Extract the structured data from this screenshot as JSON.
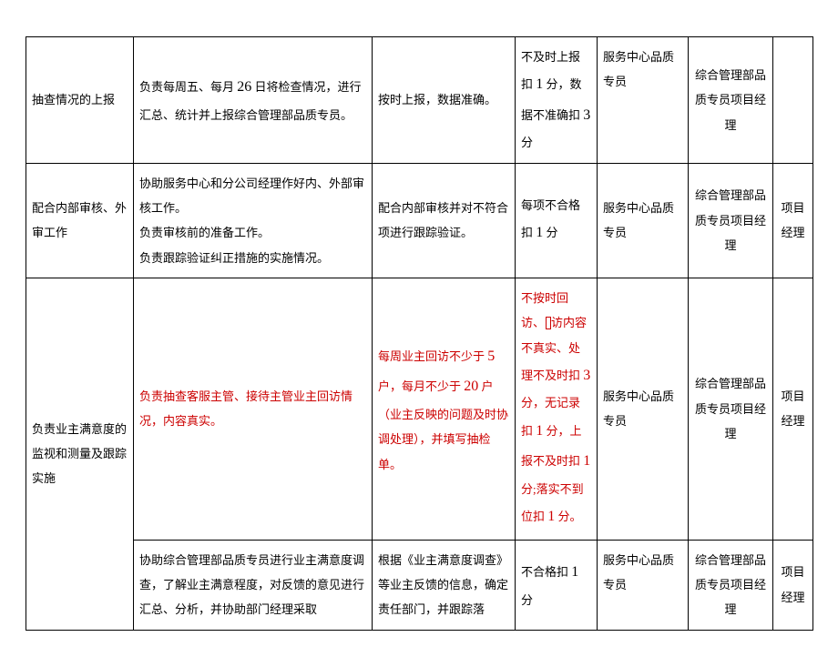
{
  "rows": {
    "r1": {
      "c1": "抽查情况的上报",
      "c2_a": "负责每周五、每月 ",
      "c2_num": "26",
      "c2_b": " 日将检查情况，进行汇总、统计并上报综合管理部品质专员。",
      "c3": "按时上报，数据准确。",
      "c4_a": "不及时上报扣 ",
      "c4_n1": "1",
      "c4_b": " 分，数据不准确扣 ",
      "c4_n2": "3",
      "c4_c": " 分",
      "c5": "服务中心品质专员",
      "c6": "综合管理部品质专员项目经理",
      "c7": ""
    },
    "r2": {
      "c1": "配合内部审核、外审工作",
      "c2_l1": "协助服务中心和分公司经理作好内、外部审核工作。",
      "c2_l2": "负责审核前的准备工作。",
      "c2_l3": "负责跟踪验证纠正措施的实施情况。",
      "c3": "配合内部审核并对不符合项进行跟踪验证。",
      "c4_a": "每项不合格扣 ",
      "c4_n1": "1",
      "c4_b": " 分",
      "c5": "服务中心品质专员",
      "c6": "综合管理部品质专员项目经理",
      "c7": "项目经理"
    },
    "r3": {
      "c1": "负责业主满意度的监视和测量及跟踪实施",
      "c2": "负责抽查客服主管、接待主管业主回访情况，内容真实。",
      "c3_a": "每周业主回访不少于 ",
      "c3_n1": "5",
      "c3_b": " 户，每月不少于 ",
      "c3_n2": "20",
      "c3_c": " 户（业主反映的问题及时协调处理），并填写抽检单。",
      "c4_a": "不按时回访、",
      "c4_b": "访内容不真实、处理不及时扣 ",
      "c4_n1": "3",
      "c4_c": " 分，无记录扣 ",
      "c4_n2": "1",
      "c4_d": " 分，上报不及时扣 ",
      "c4_n3": "1",
      "c4_e": " 分;落实不到位扣 ",
      "c4_n4": "1",
      "c4_f": " 分。",
      "c5": "服务中心品质专员",
      "c6": "综合管理部品质专员项目经理",
      "c7": "项目经理"
    },
    "r4": {
      "c2": "协助综合管理部品质专员进行业主满意度调查，了解业主满意程度，对反馈的意见进行汇总、分析，并协助部门经理采取",
      "c3": "根据《业主满意度调查》等业主反馈的信息，确定责任部门，并跟踪落",
      "c4_a": "不合格扣 ",
      "c4_n1": "1",
      "c4_b": " 分",
      "c5": "服务中心品质专员",
      "c6": "综合管理部品质专员项目经理",
      "c7": "项目经理"
    }
  }
}
